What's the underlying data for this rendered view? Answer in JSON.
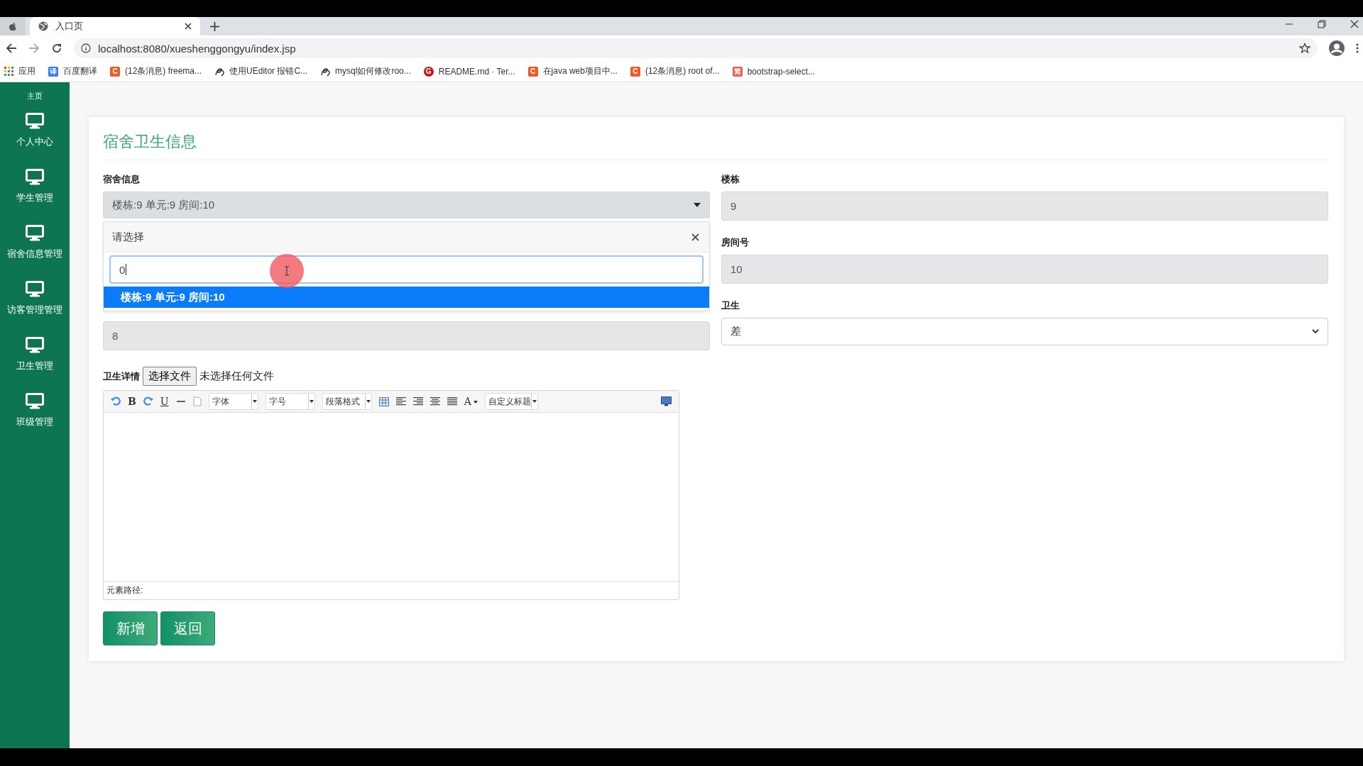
{
  "browser": {
    "tab_title": "入口页",
    "url": "localhost:8080/xueshenggongyu/index.jsp",
    "bookmarks": [
      {
        "label": "应用",
        "kind": "apps"
      },
      {
        "label": "百度翻译",
        "kind": "badge",
        "badge": "译",
        "color": "#2f7cf6"
      },
      {
        "label": "(12条消息) freema...",
        "kind": "badge",
        "badge": "C",
        "color": "#f05a28"
      },
      {
        "label": "使用UEditor 报错C...",
        "kind": "swirl"
      },
      {
        "label": "mysql如何修改roo...",
        "kind": "swirl"
      },
      {
        "label": "README.md · Ter...",
        "kind": "round",
        "badge": "G",
        "color": "#c7161e"
      },
      {
        "label": "在java web项目中...",
        "kind": "badge",
        "badge": "C",
        "color": "#f05a28"
      },
      {
        "label": "(12条消息) root of...",
        "kind": "badge",
        "badge": "C",
        "color": "#f05a28"
      },
      {
        "label": "bootstrap-select...",
        "kind": "badge",
        "badge": "简",
        "color": "#e8604c"
      }
    ]
  },
  "sidebar": {
    "items": [
      {
        "label": "主页",
        "kind": "partial"
      },
      {
        "label": "个人中心",
        "kind": "item"
      },
      {
        "label": "学生管理",
        "kind": "item"
      },
      {
        "label": "宿舍信息管理",
        "kind": "item"
      },
      {
        "label": "访客管理管理",
        "kind": "item"
      },
      {
        "label": "卫生管理",
        "kind": "item"
      },
      {
        "label": "班级管理",
        "kind": "item"
      }
    ]
  },
  "form": {
    "title": "宿舍卫生信息",
    "dorm_select": {
      "label": "宿舍信息",
      "value": "楼栋:9 单元:9 房间:10",
      "expanded": true
    },
    "dropdown": {
      "header": "请选择",
      "search_value": "0",
      "options": [
        {
          "label": "楼栋:9 单元:9 房间:10",
          "selected": true
        }
      ]
    },
    "unit_field": {
      "value": "8"
    },
    "right_fields": [
      {
        "label": "楼栋",
        "value": "9",
        "kind": "input"
      },
      {
        "label": "房间号",
        "value": "10",
        "kind": "input"
      },
      {
        "label": "卫生",
        "value": "差",
        "kind": "select"
      }
    ],
    "detail": {
      "label": "卫生详情",
      "file_button": "选择文件",
      "file_status": "未选择任何文件"
    },
    "editor": {
      "toolbar": [
        {
          "kind": "undo"
        },
        {
          "kind": "bold",
          "label": "B"
        },
        {
          "kind": "redo"
        },
        {
          "kind": "underline",
          "label": "U"
        },
        {
          "kind": "hr"
        },
        {
          "kind": "page"
        },
        {
          "kind": "combo",
          "label": "字体"
        },
        {
          "kind": "combo",
          "label": "字号"
        },
        {
          "kind": "combo",
          "label": "段落格式"
        },
        {
          "kind": "table"
        },
        {
          "kind": "align-left"
        },
        {
          "kind": "align-right"
        },
        {
          "kind": "align-center"
        },
        {
          "kind": "align-justify"
        },
        {
          "kind": "color",
          "label": "A"
        },
        {
          "kind": "combo",
          "label": "自定义标题"
        }
      ],
      "status": "元素路径:"
    },
    "buttons": [
      {
        "label": "新增"
      },
      {
        "label": "返回"
      }
    ]
  }
}
